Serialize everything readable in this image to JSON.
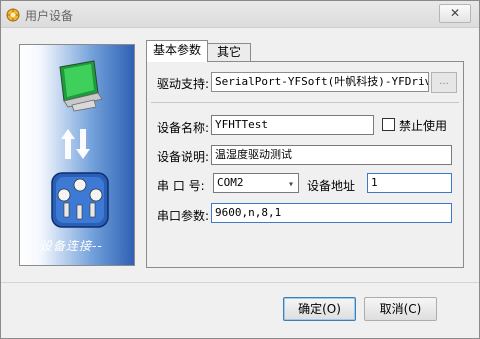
{
  "window": {
    "title": "用户设备",
    "close_label": "✕"
  },
  "side_panel": {
    "caption": "设备连接--"
  },
  "tabs": [
    {
      "label": "基本参数"
    },
    {
      "label": "其它"
    }
  ],
  "form": {
    "driver_label": "驱动支持:",
    "driver_value": "SerialPort-YFSoft(叶帆科技)-YFDrive",
    "browse_label": "...",
    "device_name_label": "设备名称:",
    "device_name_value": "YFHTTest",
    "disable_label": "禁止使用",
    "description_label": "设备说明:",
    "description_value": "温湿度驱动测试",
    "port_label": "串 口 号:",
    "port_value": "COM2",
    "address_label": "设备地址",
    "address_value": "1",
    "serial_params_label": "串口参数:",
    "serial_params_value": "9600,n,8,1"
  },
  "buttons": {
    "ok_label": "确定(O)",
    "cancel_label": "取消(C)"
  }
}
